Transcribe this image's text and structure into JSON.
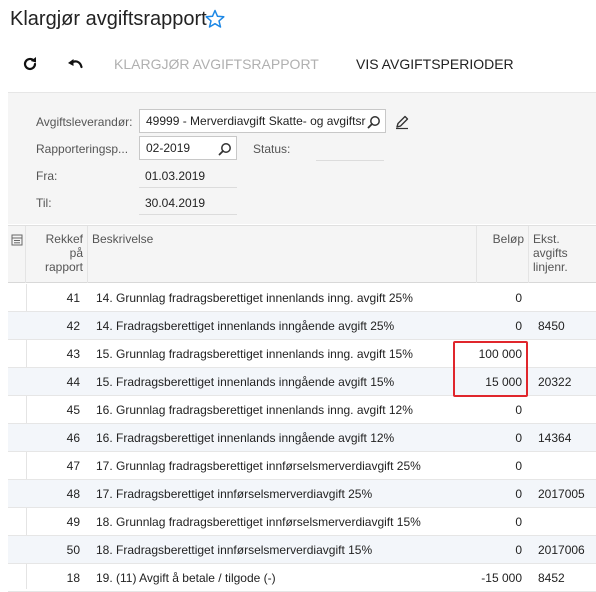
{
  "header": {
    "title": "Klargjør avgiftsrapport",
    "favorite_icon": "star-outline-icon"
  },
  "toolbar": {
    "refresh_icon": "refresh-icon",
    "undo_icon": "undo-icon",
    "prepare_report_label": "KLARGJØR AVGIFTSRAPPORT",
    "view_periods_label": "VIS AVGIFTSPERIODER"
  },
  "form": {
    "vendor_label": "Avgiftsleverandør:",
    "vendor_value": "49999 - Merverdiavgift Skatte- og avgiftsr",
    "period_label": "Rapporteringsp...",
    "period_value": "02-2019",
    "status_label": "Status:",
    "status_value": "",
    "from_label": "Fra:",
    "from_value": "01.03.2019",
    "to_label": "Til:",
    "to_value": "30.04.2019"
  },
  "grid": {
    "columns": {
      "rank": [
        "Rekkef",
        "på",
        "rapport"
      ],
      "description": "Beskrivelse",
      "amount": "Beløp",
      "ext": [
        "Ekst.",
        "avgifts",
        "linjenr."
      ]
    },
    "rows": [
      {
        "rank": "41",
        "description": "14. Grunnlag fradragsberettiget innenlands inng. avgift 25%",
        "amount": "0",
        "ext": ""
      },
      {
        "rank": "42",
        "description": "14. Fradragsberettiget innenlands inngående avgift 25%",
        "amount": "0",
        "ext": "8450"
      },
      {
        "rank": "43",
        "description": "15. Grunnlag fradragsberettiget innenlands inng. avgift 15%",
        "amount": "100 000",
        "ext": ""
      },
      {
        "rank": "44",
        "description": "15. Fradragsberettiget innenlands inngående avgift 15%",
        "amount": "15 000",
        "ext": "20322"
      },
      {
        "rank": "45",
        "description": "16. Grunnlag fradragsberettiget innenlands inng. avgift 12%",
        "amount": "0",
        "ext": ""
      },
      {
        "rank": "46",
        "description": "16. Fradragsberettiget innenlands inngående avgift 12%",
        "amount": "0",
        "ext": "14364"
      },
      {
        "rank": "47",
        "description": "17. Grunnlag fradragsberettiget innførselsmerverdiavgift 25%",
        "amount": "0",
        "ext": ""
      },
      {
        "rank": "48",
        "description": "17. Fradragsberettiget innførselsmerverdiavgift 25%",
        "amount": "0",
        "ext": "2017005"
      },
      {
        "rank": "49",
        "description": "18. Grunnlag fradragsberettiget innførselsmerverdiavgift 15%",
        "amount": "0",
        "ext": ""
      },
      {
        "rank": "50",
        "description": "18. Fradragsberettiget innførselsmerverdiavgift 15%",
        "amount": "0",
        "ext": "2017006"
      },
      {
        "rank": "18",
        "description": "19. (11) Avgift å betale / tilgode (-)",
        "amount": "-15 000",
        "ext": "8452"
      }
    ]
  },
  "colors": {
    "accent": "#1e88e5",
    "highlight": "#e0262c",
    "disabled_text": "#b0b0b0"
  }
}
